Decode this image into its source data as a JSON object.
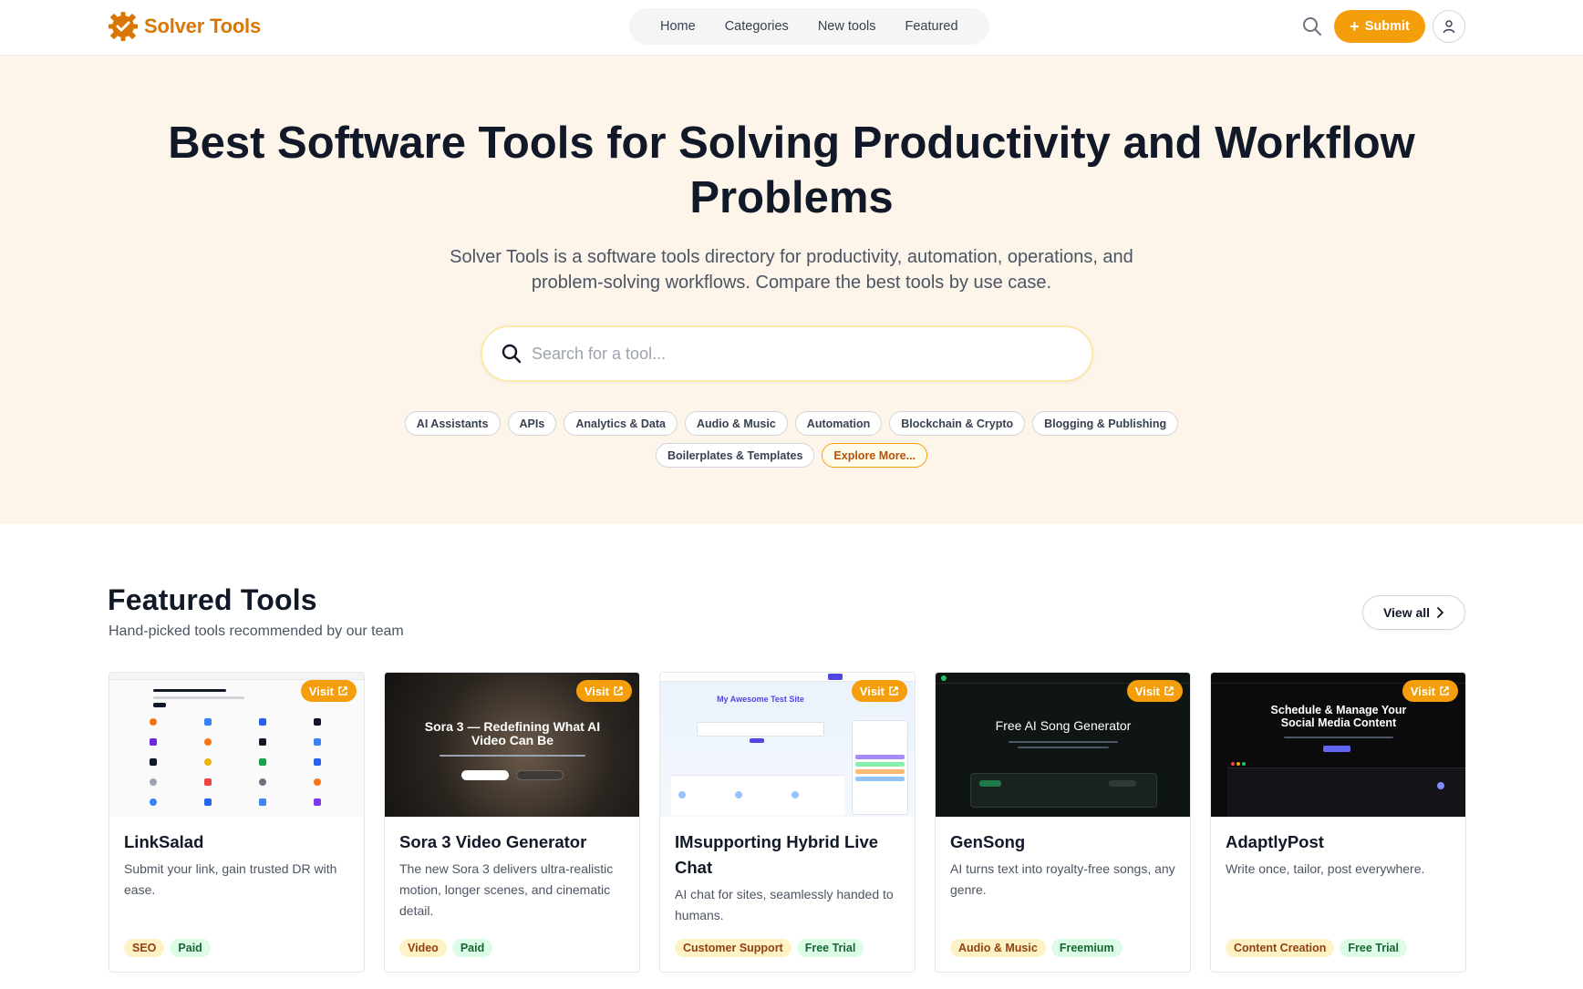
{
  "brand": {
    "name": "Solver Tools",
    "accent": "#f59e0b",
    "brand_color": "#d97706"
  },
  "nav": {
    "items": [
      "Home",
      "Categories",
      "New tools",
      "Featured"
    ]
  },
  "header": {
    "submit_label": "Submit",
    "search_icon": "search-icon",
    "user_icon": "user-icon"
  },
  "hero": {
    "title": "Best Software Tools for Solving Productivity and Workflow Problems",
    "subtitle": "Solver Tools is a software tools directory for productivity, automation, operations, and problem-solving workflows. Compare the best tools by use case.",
    "search_placeholder": "Search for a tool...",
    "chips_row1": [
      "AI Assistants",
      "APIs",
      "Analytics & Data",
      "Audio & Music",
      "Automation",
      "Blockchain & Crypto",
      "Blogging & Publishing"
    ],
    "chips_row2": [
      "Boilerplates & Templates"
    ],
    "explore_more": "Explore More..."
  },
  "featured": {
    "title": "Featured Tools",
    "subtitle": "Hand-picked tools recommended by our team",
    "view_all": "View all",
    "visit_label": "Visit",
    "cards": [
      {
        "name": "LinkSalad",
        "desc": "Submit your link, gain trusted DR with ease.",
        "category": "SEO",
        "pricing": "Paid",
        "thumb_text": ""
      },
      {
        "name": "Sora 3 Video Generator",
        "desc": "The new Sora 3 delivers ultra-realistic motion, longer scenes, and cinematic detail.",
        "category": "Video",
        "pricing": "Paid",
        "thumb_text": "Sora 3 — Redefining What AI Video Can Be"
      },
      {
        "name": "IMsupporting Hybrid Live Chat",
        "desc": "AI chat for sites, seamlessly handed to humans.",
        "category": "Customer Support",
        "pricing": "Free Trial",
        "thumb_text": "My Awesome Test Site"
      },
      {
        "name": "GenSong",
        "desc": "AI turns text into royalty-free songs, any genre.",
        "category": "Audio & Music",
        "pricing": "Freemium",
        "thumb_text": "Free AI Song Generator"
      },
      {
        "name": "AdaptlyPost",
        "desc": "Write once, tailor, post everywhere.",
        "category": "Content Creation",
        "pricing": "Free Trial",
        "thumb_text": "Schedule & Manage Your Social Media Content"
      }
    ]
  }
}
